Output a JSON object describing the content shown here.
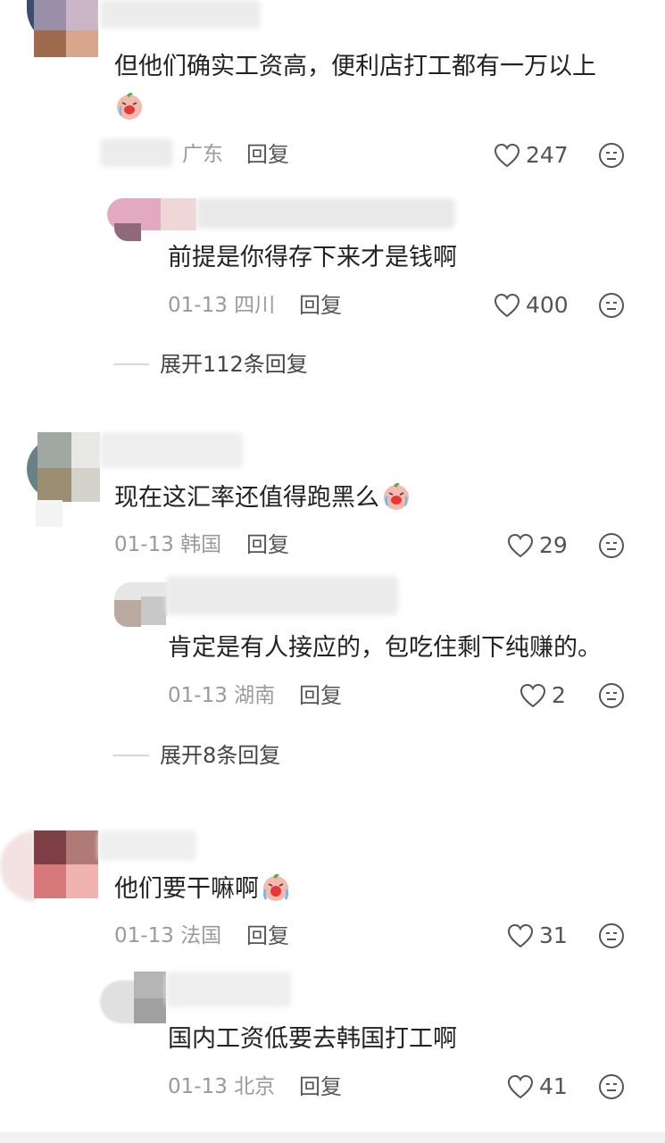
{
  "comments": [
    {
      "text": "但他们确实工资高，便利店打工都有一万以上",
      "meta": "广东",
      "reply_label": "回复",
      "likes": "247",
      "reply": {
        "text": "前提是你得存下来才是钱啊",
        "meta": "01-13 四川",
        "reply_label": "回复",
        "likes": "400"
      },
      "expand_label": "展开112条回复"
    },
    {
      "text": "现在这汇率还值得跑黑么",
      "meta": "01-13 韩国",
      "reply_label": "回复",
      "likes": "29",
      "reply": {
        "text": "肯定是有人接应的，包吃住剩下纯赚的。",
        "meta": "01-13 湖南",
        "reply_label": "回复",
        "likes": "2"
      },
      "expand_label": "展开8条回复"
    },
    {
      "text": "他们要干嘛啊",
      "meta": "01-13 法国",
      "reply_label": "回复",
      "likes": "31",
      "reply": {
        "text": "国内工资低要去韩国打工啊",
        "meta": "01-13 北京",
        "reply_label": "回复",
        "likes": "41"
      }
    }
  ],
  "icons": {
    "like": "heart-outline-icon",
    "react": "emoji-face-icon",
    "sticker": "crying-peach-sticker-icon"
  },
  "colors": {
    "text": "#222222",
    "meta": "#9a9a9a",
    "icon": "#555555"
  }
}
